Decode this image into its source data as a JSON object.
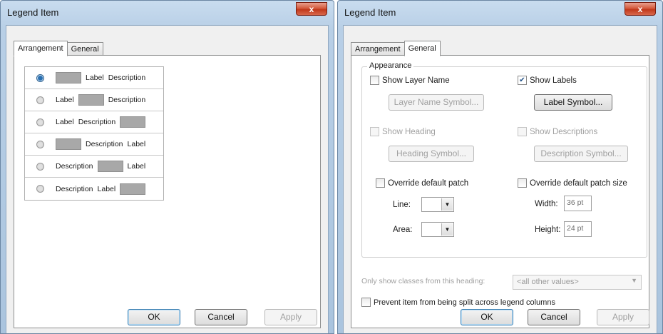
{
  "window1": {
    "title": "Legend Item",
    "close_label": "x",
    "tabs": [
      "Arrangement",
      "General"
    ],
    "arrangements": [
      {
        "items": [
          "patch",
          "Label",
          "Description"
        ],
        "selected": true
      },
      {
        "items": [
          "Label",
          "patch",
          "Description"
        ],
        "selected": false
      },
      {
        "items": [
          "Label",
          "Description",
          "patch"
        ],
        "selected": false
      },
      {
        "items": [
          "patch",
          "Description",
          "Label"
        ],
        "selected": false
      },
      {
        "items": [
          "Description",
          "patch",
          "Label"
        ],
        "selected": false
      },
      {
        "items": [
          "Description",
          "Label",
          "patch"
        ],
        "selected": false
      }
    ],
    "buttons": {
      "ok": "OK",
      "cancel": "Cancel",
      "apply": "Apply"
    }
  },
  "window2": {
    "title": "Legend Item",
    "close_label": "x",
    "tabs": [
      "Arrangement",
      "General"
    ],
    "appearance": {
      "legend": "Appearance",
      "show_layer_name": "Show Layer Name",
      "show_labels": "Show Labels",
      "layer_name_symbol": "Layer Name Symbol...",
      "label_symbol": "Label Symbol...",
      "show_heading": "Show Heading",
      "show_descriptions": "Show Descriptions",
      "heading_symbol": "Heading Symbol...",
      "description_symbol": "Description Symbol...",
      "override_patch": "Override default patch",
      "override_patch_size": "Override default patch size",
      "line_label": "Line:",
      "area_label": "Area:",
      "width_label": "Width:",
      "height_label": "Height:",
      "width_value": "36 pt",
      "height_value": "24 pt"
    },
    "only_show_label": "Only show classes from this heading:",
    "only_show_value": "<all other values>",
    "prevent_split": "Prevent item from being split across legend columns",
    "buttons": {
      "ok": "OK",
      "cancel": "Cancel",
      "apply": "Apply"
    }
  },
  "icons": {
    "checkmark": "✔",
    "dropdown": "▼"
  }
}
